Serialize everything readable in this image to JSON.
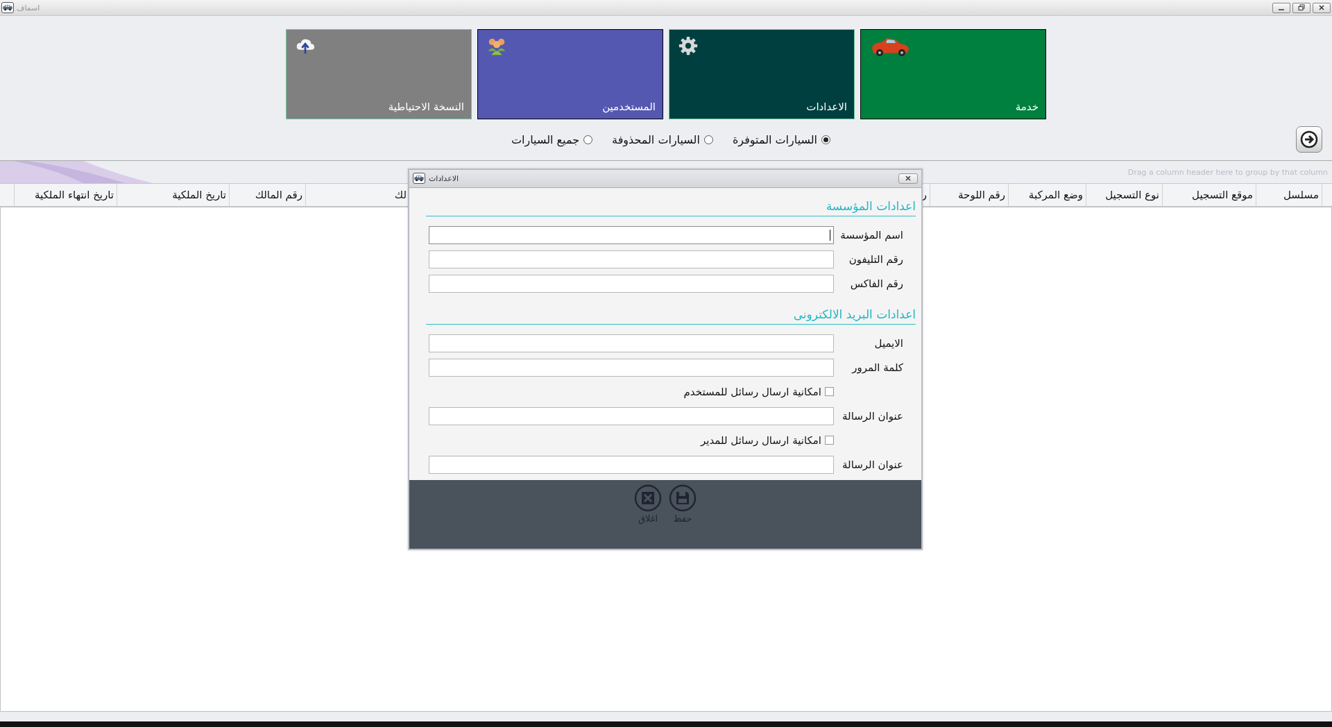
{
  "window": {
    "title": "اسماف"
  },
  "tiles": [
    {
      "label": "خدمة",
      "kind": "car",
      "color": "#00803f"
    },
    {
      "label": "الاعدادات",
      "kind": "gear",
      "color": "#003f40"
    },
    {
      "label": "المستخدمين",
      "kind": "users",
      "color": "#5458b0"
    },
    {
      "label": "النسخة الاحتياطية",
      "kind": "cloud",
      "color": "#808080"
    }
  ],
  "filters": [
    {
      "label": "السيارات المتوفرة",
      "selected": true
    },
    {
      "label": "السيارات المحذوفة",
      "selected": false
    },
    {
      "label": "جميع السيارات",
      "selected": false
    }
  ],
  "grid": {
    "group_hint": "Drag a column header here to group by that column",
    "columns": [
      {
        "label": "مسلسل"
      },
      {
        "label": "موقع التسجيل"
      },
      {
        "label": "نوع التسجيل"
      },
      {
        "label": "وضع المركبة"
      },
      {
        "label": "رقم اللوحة"
      },
      {
        "label": "ر"
      },
      {
        "label": "لك"
      },
      {
        "label": "رقم المالك"
      },
      {
        "label": "تاريخ الملكية"
      },
      {
        "label": "تاريخ انتهاء الملكية"
      }
    ]
  },
  "dialog": {
    "title": "الاعدادات",
    "sections": [
      {
        "heading": "اعدادات المؤسسة",
        "rows": [
          {
            "kind": "field",
            "label": "اسم المؤسسة",
            "focused": true
          },
          {
            "kind": "field",
            "label": "رقم التليفون",
            "focused": false
          },
          {
            "kind": "field",
            "label": "رقم الفاكس",
            "focused": false
          }
        ]
      },
      {
        "heading": "اعدادات البريد الالكترونى",
        "rows": [
          {
            "kind": "field",
            "label": "الايميل",
            "focused": false
          },
          {
            "kind": "field",
            "label": "كلمة المرور",
            "focused": false
          },
          {
            "kind": "checkbox",
            "label": "امكانية ارسال رسائل للمستخدم",
            "checked": false
          },
          {
            "kind": "field",
            "label": "عنوان الرسالة",
            "focused": false
          },
          {
            "kind": "checkbox",
            "label": "امكانية ارسال رسائل للمدير",
            "checked": false
          },
          {
            "kind": "field",
            "label": "عنوان الرسالة",
            "focused": false
          }
        ]
      }
    ],
    "buttons": [
      {
        "label": "حفظ",
        "kind": "save"
      },
      {
        "label": "اغلاق",
        "kind": "close"
      }
    ]
  }
}
